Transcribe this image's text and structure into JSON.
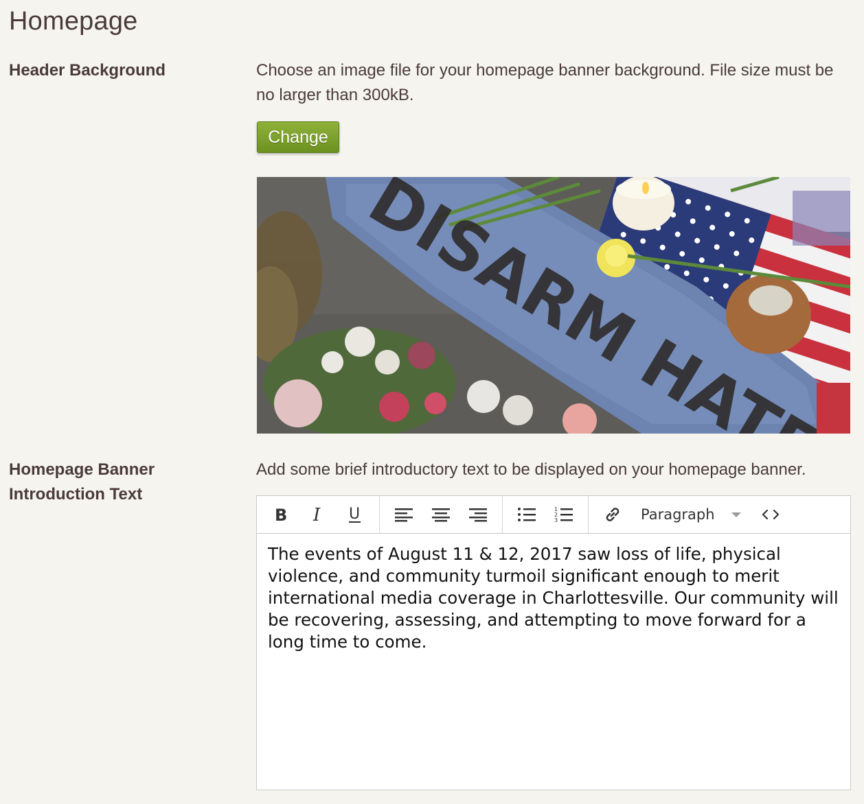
{
  "page": {
    "title": "Homepage"
  },
  "header_background": {
    "label": "Header Background",
    "help": "Choose an image file for your homepage banner background. File size must be no larger than 300kB.",
    "change_button": "Change",
    "image_text": "DISARM HATE"
  },
  "banner_intro": {
    "label_line1": "Homepage Banner",
    "label_line2": "Introduction Text",
    "help": "Add some brief introductory text to be displayed on your homepage banner.",
    "toolbar": {
      "bold": "B",
      "italic": "I",
      "underline": "U",
      "format_value": "Paragraph",
      "icons": [
        "bold-icon",
        "italic-icon",
        "underline-icon",
        "align-left-icon",
        "align-center-icon",
        "align-right-icon",
        "bullet-list-icon",
        "numbered-list-icon",
        "link-icon",
        "chevron-down-icon",
        "code-icon"
      ]
    },
    "content": "The events of August 11 & 12, 2017 saw loss of life, physical violence, and community turmoil significant enough to merit international media coverage in Charlottesville. Our community will be recovering, assessing, and attempting to move forward for a long time to come."
  },
  "colors": {
    "background": "#f5f4ef",
    "text": "#4a3b38",
    "button_green": "#7aa12c"
  }
}
